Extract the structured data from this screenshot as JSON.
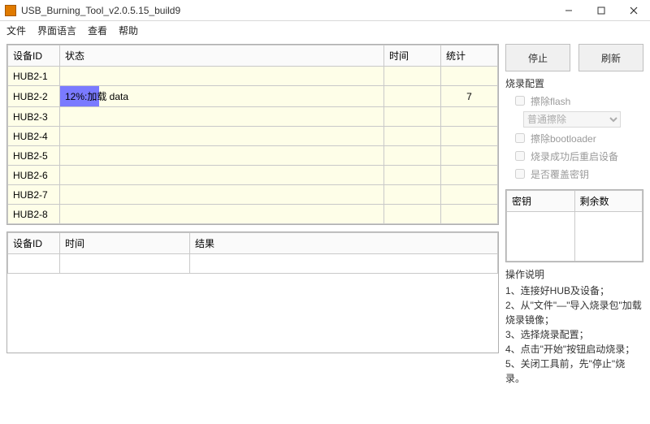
{
  "window": {
    "title": "USB_Burning_Tool_v2.0.5.15_build9"
  },
  "menu": [
    "文件",
    "界面语言",
    "查看",
    "帮助"
  ],
  "deviceTable": {
    "headers": {
      "id": "设备ID",
      "status": "状态",
      "time": "时间",
      "stats": "统计"
    },
    "rows": [
      {
        "id": "HUB2-1",
        "status": "",
        "progress": 0,
        "time": "",
        "stats": ""
      },
      {
        "id": "HUB2-2",
        "status": "12%:加载 data",
        "progress": 12,
        "time": "",
        "stats": "7"
      },
      {
        "id": "HUB2-3",
        "status": "",
        "progress": 0,
        "time": "",
        "stats": ""
      },
      {
        "id": "HUB2-4",
        "status": "",
        "progress": 0,
        "time": "",
        "stats": ""
      },
      {
        "id": "HUB2-5",
        "status": "",
        "progress": 0,
        "time": "",
        "stats": ""
      },
      {
        "id": "HUB2-6",
        "status": "",
        "progress": 0,
        "time": "",
        "stats": ""
      },
      {
        "id": "HUB2-7",
        "status": "",
        "progress": 0,
        "time": "",
        "stats": ""
      },
      {
        "id": "HUB2-8",
        "status": "",
        "progress": 0,
        "time": "",
        "stats": ""
      }
    ]
  },
  "logTable": {
    "headers": {
      "id": "设备ID",
      "time": "时间",
      "result": "结果"
    },
    "rows": []
  },
  "buttons": {
    "stop": "停止",
    "refresh": "刷新"
  },
  "config": {
    "title": "烧录配置",
    "eraseFlash": "擦除flash",
    "eraseMode": "普通擦除",
    "eraseBootloader": "擦除bootloader",
    "rebootAfter": "烧录成功后重启设备",
    "overwriteKey": "是否覆盖密钥"
  },
  "keyTable": {
    "headers": {
      "key": "密钥",
      "remaining": "剩余数"
    }
  },
  "instructions": {
    "title": "操作说明",
    "items": [
      "1、连接好HUB及设备；",
      "2、从\"文件\"—\"导入烧录包\"加载烧录镜像；",
      "3、选择烧录配置；",
      "4、点击\"开始\"按钮启动烧录；",
      "5、关闭工具前，先\"停止\"烧录。"
    ]
  }
}
